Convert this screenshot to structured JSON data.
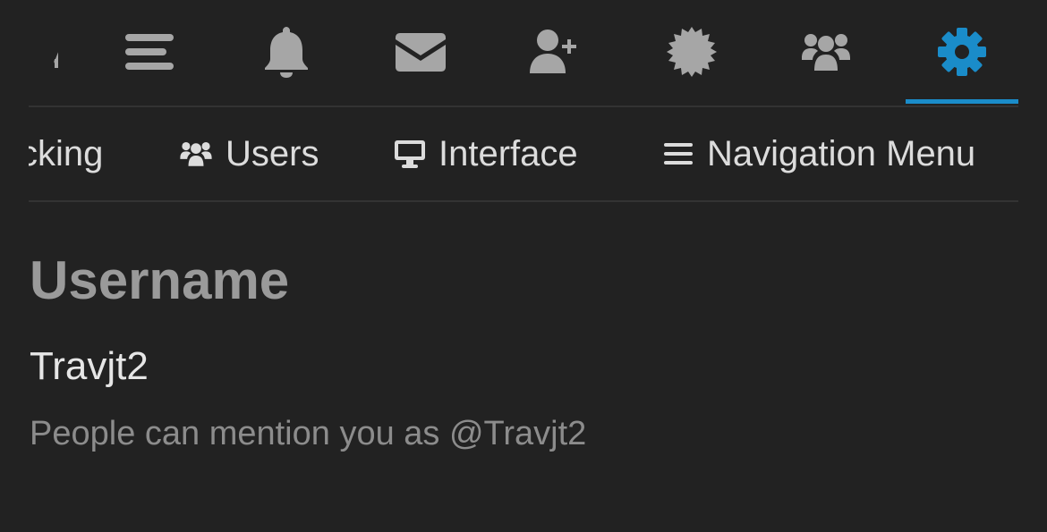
{
  "top_nav": {
    "icons": [
      {
        "name": "partial-icon",
        "active": false
      },
      {
        "name": "menu-icon",
        "active": false
      },
      {
        "name": "bell-icon",
        "active": false
      },
      {
        "name": "envelope-icon",
        "active": false
      },
      {
        "name": "user-plus-icon",
        "active": false
      },
      {
        "name": "badge-icon",
        "active": false
      },
      {
        "name": "users-icon",
        "active": false
      },
      {
        "name": "gear-icon",
        "active": true
      }
    ],
    "icon_color": "#a6a6a6",
    "active_color": "#1a8cc9"
  },
  "tabs": [
    {
      "label": "cking",
      "icon": ""
    },
    {
      "label": "Users",
      "icon": "users-icon"
    },
    {
      "label": "Interface",
      "icon": "desktop-icon"
    },
    {
      "label": "Navigation Menu",
      "icon": "bars-icon"
    }
  ],
  "settings": {
    "section_title": "Username",
    "username": "Travjt2",
    "helper_text": "People can mention you as @Travjt2"
  }
}
